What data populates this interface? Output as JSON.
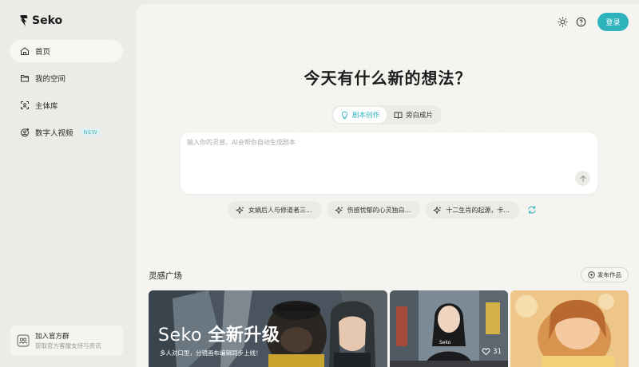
{
  "sidebar": {
    "logo_text": "Seko",
    "items": [
      {
        "label": "首页",
        "icon": "home-icon",
        "active": true
      },
      {
        "label": "我的空间",
        "icon": "folder-icon"
      },
      {
        "label": "主体库",
        "icon": "scan-face-icon"
      },
      {
        "label": "数字人视频",
        "icon": "avatar-video-icon",
        "badge": "NEW"
      }
    ],
    "join": {
      "title": "加入官方群",
      "subtitle": "获取官方客服支持与资讯"
    }
  },
  "header": {
    "login_label": "登录"
  },
  "hero": {
    "headline": "今天有什么新的想法？"
  },
  "modes": [
    {
      "label": "剧本创作",
      "icon": "bulb-icon",
      "active": true
    },
    {
      "label": "旁白成片",
      "icon": "book-icon"
    }
  ],
  "prompt": {
    "placeholder": "输入你的灵感，AI会帮你自动生成剧本",
    "value": ""
  },
  "suggestions": [
    "女娲后人与修道者三...",
    "伤感忧郁的心灵独白...",
    "十二生肖的起源，卡..."
  ],
  "gallery": {
    "title": "灵感广场",
    "publish_label": "发布作品",
    "cards": [
      {
        "headline_brand": "Seko",
        "headline_rest": "全新升级",
        "subtitle": "多人对口型，分镜画布编辑同步上线！"
      },
      {
        "likes": "31",
        "shirt_text": "Seko"
      },
      {}
    ]
  },
  "colors": {
    "accent": "#2eb3bd",
    "background": "#ecebe7",
    "panel": "#f5f4f0"
  }
}
